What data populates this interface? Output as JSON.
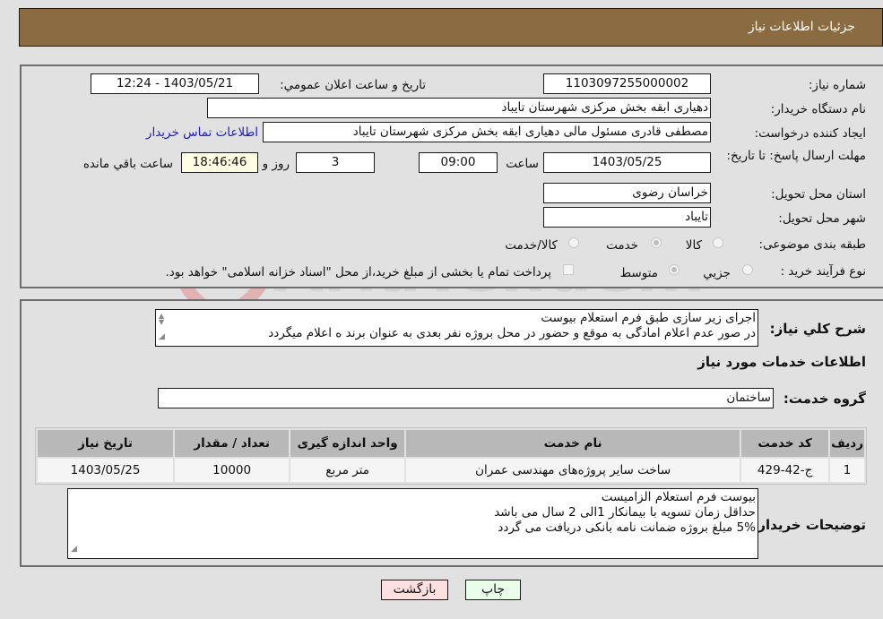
{
  "header": {
    "title": "جزئیات اطلاعات نیاز"
  },
  "details": {
    "need_number_label": "شماره نیاز:",
    "need_number": "1103097255000002",
    "announce_label": "تاریخ و ساعت اعلان عمومي:",
    "announce_value": "1403/05/21 - 12:24",
    "buyer_org_label": "نام دستگاه خریدار:",
    "buyer_org": "دهیاری ابقه بخش مرکزی شهرستان تایباد",
    "requester_label": "ایجاد کننده درخواست:",
    "requester": "مصطفی قادری مسئول مالی دهیاری ابقه بخش مرکزی شهرستان تایباد",
    "contact_link": "اطلاعات تماس خریدار",
    "deadline_label": "مهلت ارسال پاسخ: تا تاریخ:",
    "deadline_date": "1403/05/25",
    "time_label": "ساعت",
    "deadline_time": "09:00",
    "days_value": "3",
    "days_label": "روز و",
    "remaining_time": "18:46:46",
    "remaining_label": "ساعت باقي مانده",
    "province_label": "استان محل تحویل:",
    "province": "خراسان رضوی",
    "city_label": "شهر محل تحویل:",
    "city": "تایباد",
    "category_label": "طبقه بندی موضوعی:",
    "category_options": [
      {
        "label": "کالا",
        "selected": false
      },
      {
        "label": "خدمت",
        "selected": true
      },
      {
        "label": "کالا/خدمت",
        "selected": false
      }
    ],
    "process_label": "نوع فرآیند خرید :",
    "process_options": [
      {
        "label": "جزيي",
        "selected": false
      },
      {
        "label": "متوسط",
        "selected": true
      }
    ],
    "payment_note": "پرداخت تمام یا بخشی از مبلغ خرید،از محل \"اسناد خزانه اسلامی\" خواهد بود.",
    "payment_checked": false
  },
  "services": {
    "summary_label": "شرح كلي نياز:",
    "summary_lines": [
      "اجرای زیر سازی طبق فرم استعلام بیوست",
      "در صور عدم اعلام امادگی به موقع و حضور در محل بروژه نفر بعدی به عنوان برند ه اعلام میگردد"
    ],
    "section_title": "اطلاعات خدمات مورد نياز",
    "group_label": "گروه خدمت:",
    "group_value": "ساختمان",
    "table": {
      "headers": [
        "ردیف",
        "کد خدمت",
        "نام خدمت",
        "واحد اندازه گیری",
        "تعداد / مقدار",
        "تاریخ نیاز"
      ],
      "rows": [
        [
          "1",
          "ج-42-429",
          "ساخت سایر پروژه‌های مهندسی عمران",
          "متر مربع",
          "10000",
          "1403/05/25"
        ]
      ]
    },
    "buyer_notes_label": "توضیحات خریدار:",
    "buyer_notes_lines": [
      "بیوست فرم استعلام الزامیست",
      "حداقل زمان تسویه با بیمانکار 1الی 2 سال می باشد",
      "5% مبلغ بروژه ضمانت نامه بانکی دریافت می گردد"
    ]
  },
  "buttons": {
    "print": "چاپ",
    "back": "بازگشت"
  },
  "watermark": {
    "text": "AriaTender.neT"
  },
  "colors": {
    "header_bg": "#8b6b41",
    "link": "#1a1ac8",
    "print_bg": "#eaffea",
    "back_bg": "#ffe0e0"
  }
}
